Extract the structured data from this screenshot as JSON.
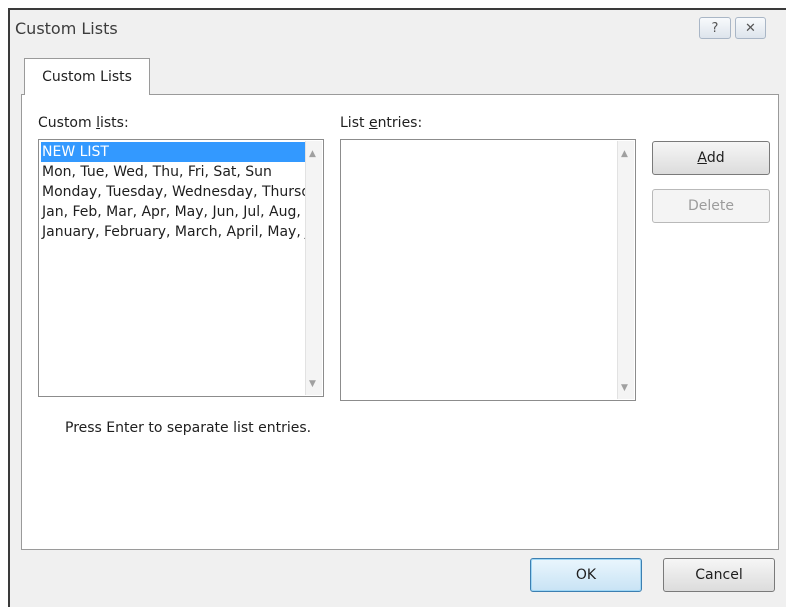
{
  "window": {
    "title": "Custom Lists",
    "help_glyph": "?",
    "close_glyph": "✕"
  },
  "tabs": [
    {
      "label": "Custom Lists",
      "selected": true
    }
  ],
  "custom_lists": {
    "label_before": "Custom ",
    "label_accel": "l",
    "label_after": "ists:",
    "items": [
      {
        "text": "NEW LIST",
        "selected": true
      },
      {
        "text": "Mon, Tue, Wed, Thu, Fri, Sat, Sun",
        "selected": false
      },
      {
        "text": "Monday, Tuesday, Wednesday, Thursday, Friday, Saturday, Sunday",
        "selected": false
      },
      {
        "text": "Jan, Feb, Mar, Apr, May, Jun, Jul, Aug, Sep, Oct, Nov, Dec",
        "selected": false
      },
      {
        "text": "January, February, March, April, May, June, July, August, September, October, November, December",
        "selected": false
      }
    ]
  },
  "list_entries": {
    "label_before": "List ",
    "label_accel": "e",
    "label_after": "ntries:",
    "value": ""
  },
  "buttons": {
    "add_accel": "A",
    "add_rest": "dd",
    "delete": "Delete",
    "delete_enabled": false,
    "ok": "OK",
    "cancel": "Cancel"
  },
  "hint": "Press Enter to separate list entries.",
  "colors": {
    "selection": "#3399ff",
    "dialog_bg": "#f0f0f0"
  }
}
